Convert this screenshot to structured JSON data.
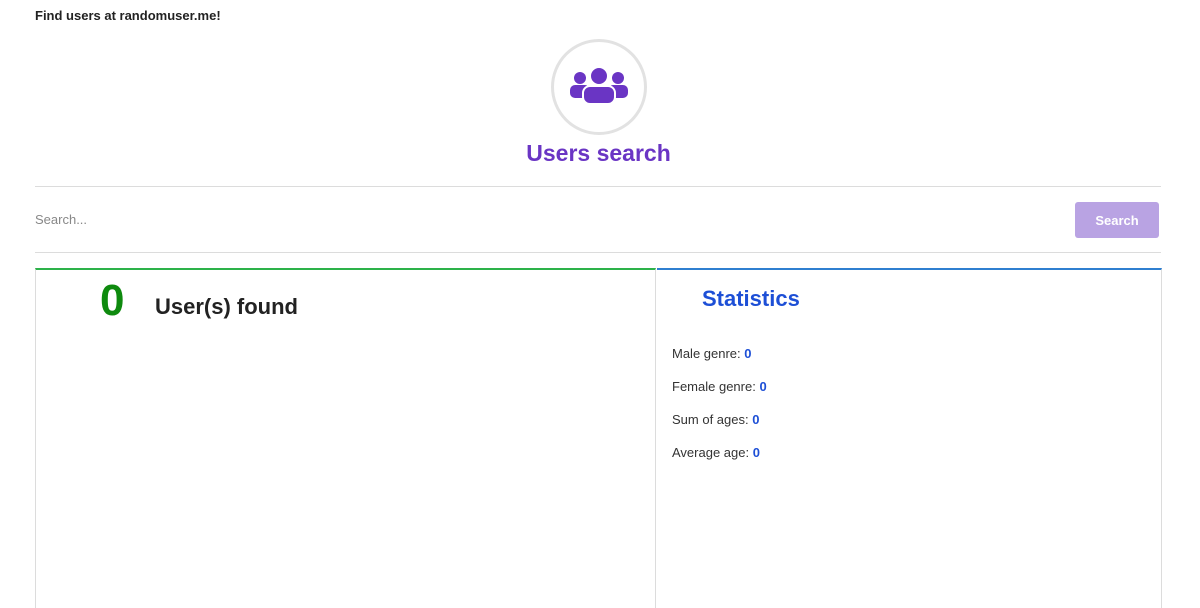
{
  "header": {
    "note": "Find users at randomuser.me!",
    "title": "Users search",
    "logo_icon": "users-group-icon"
  },
  "search": {
    "placeholder": "Search...",
    "value": "",
    "button_label": "Search"
  },
  "results": {
    "count": "0",
    "label": "User(s) found"
  },
  "statistics": {
    "title": "Statistics",
    "items": [
      {
        "label": "Male genre:",
        "value": "0"
      },
      {
        "label": "Female genre:",
        "value": "0"
      },
      {
        "label": "Sum of ages:",
        "value": "0"
      },
      {
        "label": "Average age:",
        "value": "0"
      }
    ]
  },
  "colors": {
    "brand_purple": "#6a35c4",
    "button_purple": "#b9a3e3",
    "count_green": "#0e8a0e",
    "stats_blue": "#1d4fd6",
    "left_panel_accent": "#2db24a",
    "right_panel_accent": "#2f7fd0"
  }
}
